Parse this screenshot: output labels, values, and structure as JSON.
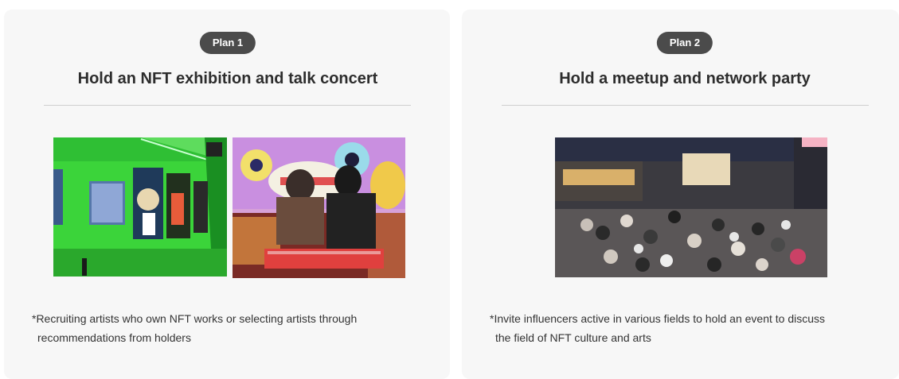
{
  "plans": [
    {
      "badge": "Plan 1",
      "title": "Hold an NFT exhibition and talk concert",
      "note_line1": "*Recruiting artists who own NFT works or selecting artists through",
      "note_line2": "recommendations from holders"
    },
    {
      "badge": "Plan 2",
      "title": "Hold a meetup and network party",
      "note_line1": "*Invite influencers active in various fields to hold an event to discuss",
      "note_line2": "the field of NFT culture and arts"
    }
  ],
  "colors": {
    "card_bg": "#f7f7f7",
    "badge_bg": "#4b4b4b",
    "title_text": "#2d2d2d",
    "divider": "#cfcfcf"
  }
}
